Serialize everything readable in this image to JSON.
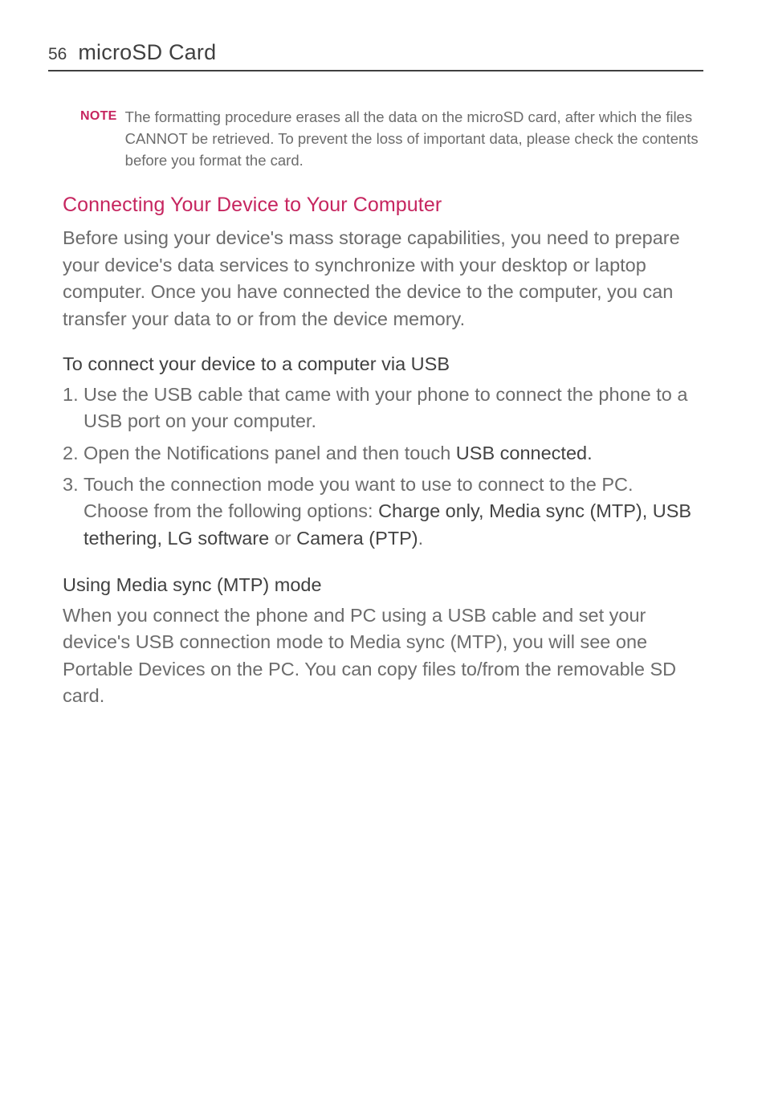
{
  "pageNumber": "56",
  "pageTitle": "microSD Card",
  "note": {
    "label": "NOTE",
    "text": "The formatting procedure erases all the data on the microSD card, after which the files CANNOT be retrieved. To prevent the loss of important data, please check the contents before you format the card."
  },
  "section1": {
    "heading": "Connecting Your Device to Your Computer",
    "body": "Before using your device's mass storage capabilities, you need to prepare your device's data services to synchronize with your desktop or laptop computer. Once you have connected the device to the computer, you can transfer your data to or from the device memory."
  },
  "section2": {
    "heading": "To connect your device to a computer via USB",
    "steps": {
      "m1": "1.",
      "m2": "2.",
      "m3": "3.",
      "s1": "Use the USB cable that came with your phone to connect the phone to a USB port on your computer.",
      "s2a": "Open the Notifications panel and then touch ",
      "s2b": "USB connected.",
      "s3a": "Touch the connection mode you want to use to connect to the PC. Choose from the following options: ",
      "s3b": "Charge only, Media sync (MTP), USB tethering, LG software",
      "s3c": " or ",
      "s3d": "Camera (PTP)",
      "s3e": "."
    }
  },
  "section3": {
    "heading": "Using Media sync (MTP) mode",
    "body": "When you connect the phone and PC using a USB cable and set your device's USB connection mode to Media sync (MTP), you will see one Portable Devices on the PC. You can copy files to/from the removable SD card."
  }
}
